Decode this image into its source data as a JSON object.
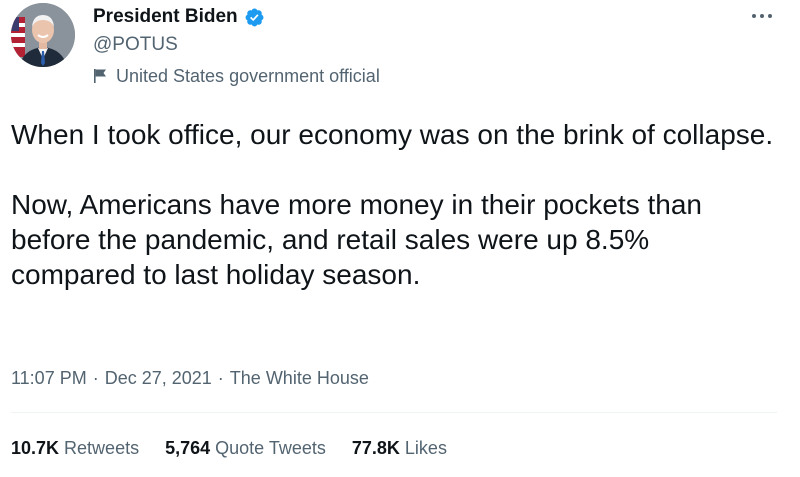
{
  "author": {
    "display_name": "President Biden",
    "handle": "@POTUS",
    "label": "United States government official"
  },
  "tweet": {
    "paragraphs": [
      "When I took office, our economy was on the brink of collapse.",
      "Now, Americans have more money in their pockets than before the pandemic, and retail sales were up 8.5% compared to last holiday season."
    ],
    "time": "11:07 PM",
    "separator": "·",
    "date": "Dec 27, 2021",
    "source": "The White House"
  },
  "stats": {
    "retweets_count": "10.7K",
    "retweets_label": "Retweets",
    "quote_count": "5,764",
    "quote_label": "Quote Tweets",
    "likes_count": "77.8K",
    "likes_label": "Likes"
  },
  "icons": {
    "verified": "verified-badge-icon",
    "flag": "flag-icon",
    "more": "more-icon"
  },
  "colors": {
    "text_primary": "#0f1419",
    "text_secondary": "#536471",
    "verified_blue": "#1d9bf0",
    "divider": "#eff3f4"
  }
}
